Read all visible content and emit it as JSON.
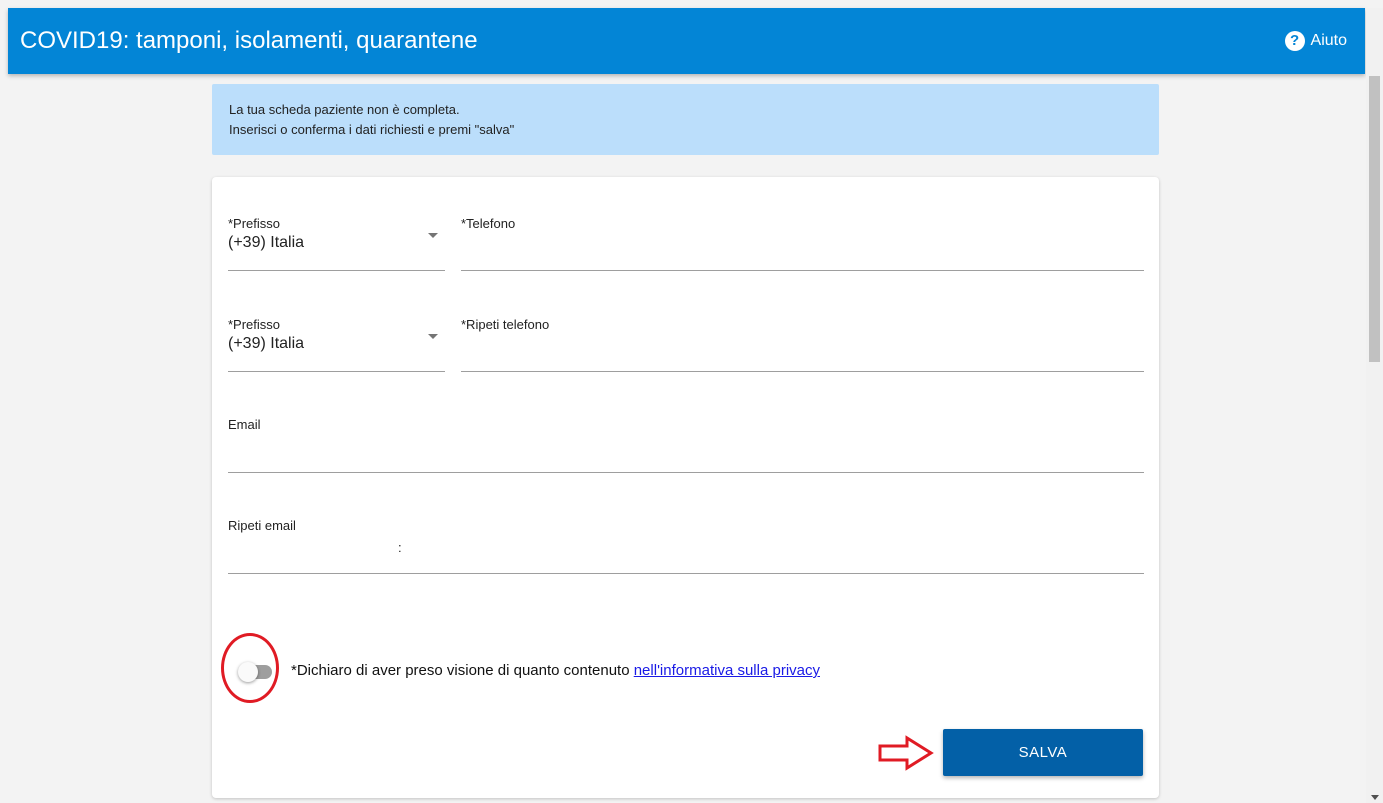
{
  "header": {
    "title": "COVID19: tamponi, isolamenti, quarantene",
    "help_label": "Aiuto",
    "help_icon": "?",
    "color": "#0385d6"
  },
  "alert": {
    "line1": "La tua scheda paziente non è completa.",
    "line2": "Inserisci o conferma i dati richiesti e premi \"salva\""
  },
  "form": {
    "prefix1": {
      "label": "*Prefisso",
      "value": "(+39) Italia"
    },
    "phone": {
      "label": "*Telefono",
      "value": ""
    },
    "prefix2": {
      "label": "*Prefisso",
      "value": "(+39) Italia"
    },
    "phone_repeat": {
      "label": "*Ripeti telefono",
      "value": ""
    },
    "email": {
      "label": "Email",
      "value": ""
    },
    "email_repeat": {
      "label": "Ripeti email",
      "value": ":"
    },
    "privacy": {
      "text": "*Dichiaro di aver preso visione di quanto contenuto ",
      "link": "nell'informativa sulla privacy",
      "checked": false
    },
    "save_label": "SALVA",
    "save_color": "#0360a7"
  },
  "annotations": {
    "color": "#e01b24"
  }
}
